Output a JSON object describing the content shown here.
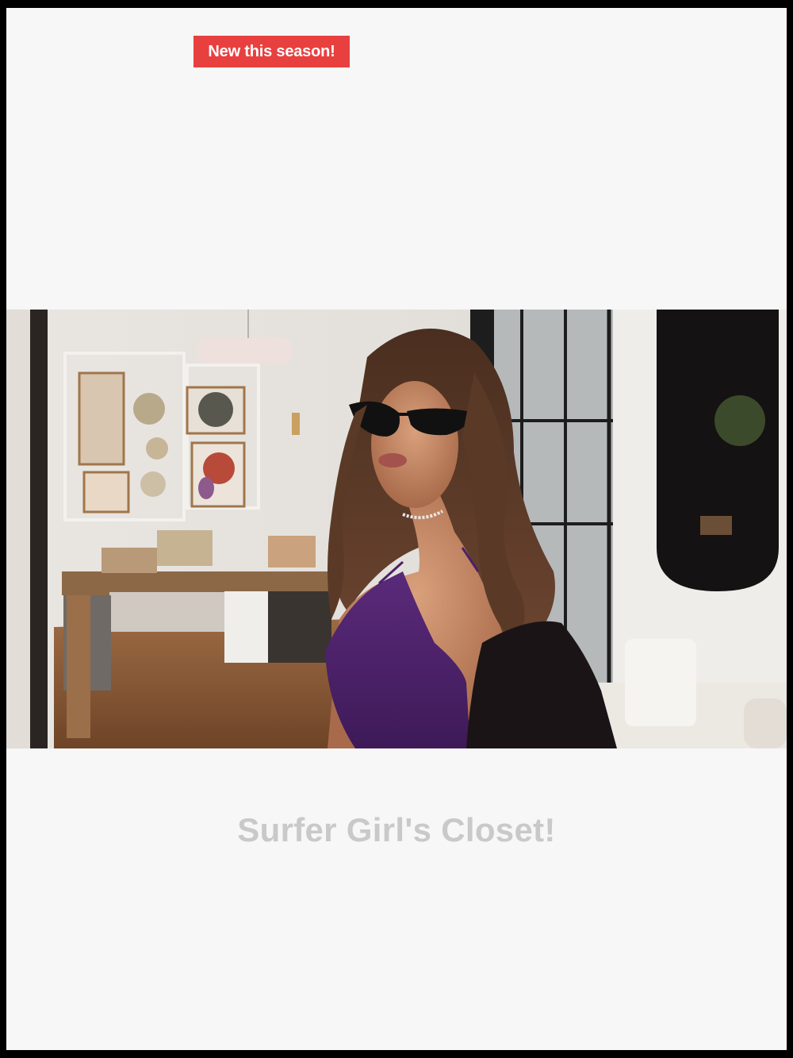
{
  "promo": {
    "badge_label": "New this season!"
  },
  "hero": {
    "image_name": "model-in-purple-lingerie-photo"
  },
  "store": {
    "title": "Surfer Girl's Closet!"
  },
  "colors": {
    "badge_background": "#e8403f",
    "page_background": "#f7f7f7",
    "title_text": "#c9c9c9",
    "frame": "#000000"
  }
}
